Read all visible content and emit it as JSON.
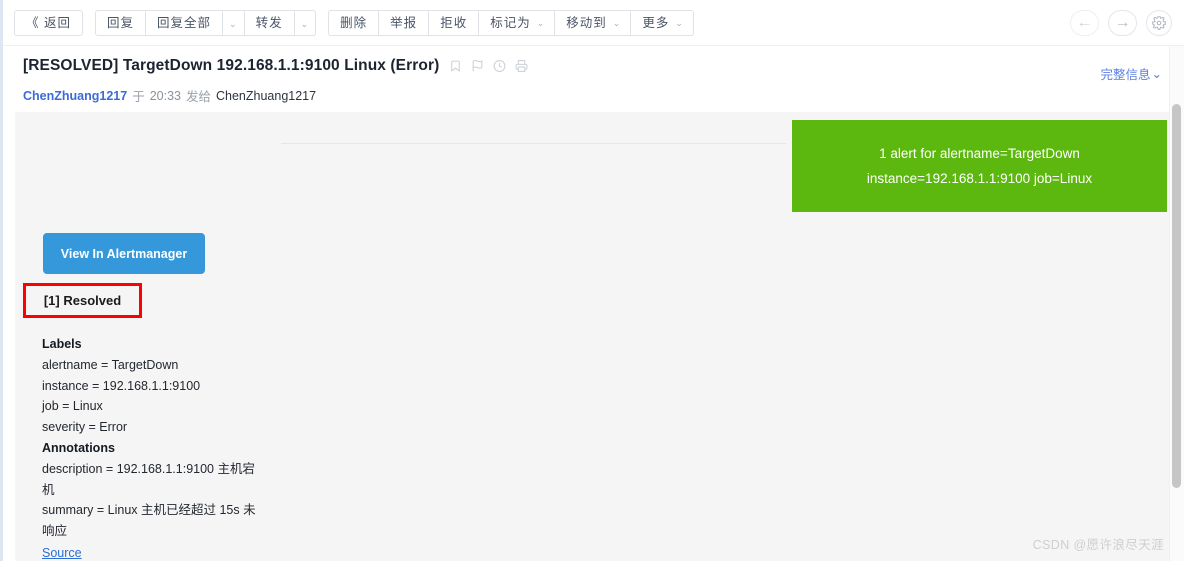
{
  "toolbar": {
    "back": "返回",
    "back_icon": "double-chevron-left-icon",
    "reply": "回复",
    "reply_all": "回复全部",
    "forward": "转发",
    "delete": "删除",
    "report": "举报",
    "reject": "拒收",
    "mark_as": "标记为",
    "move_to": "移动到",
    "more": "更多",
    "caret": "⌄"
  },
  "nav": {
    "prev_icon": "arrow-left-icon",
    "prev_glyph": "←",
    "next_icon": "arrow-right-icon",
    "next_glyph": "→",
    "settings_icon": "gear-icon"
  },
  "message": {
    "subject": "[RESOLVED] TargetDown 192.168.1.1:9100 Linux (Error)",
    "icons": [
      "bookmark-icon",
      "flag-icon",
      "clock-icon",
      "printer-icon"
    ],
    "full_info": "完整信息",
    "full_info_caret": "⌄",
    "sender": "ChenZhuang1217",
    "at": "于",
    "time": "20:33",
    "sent_to": "发给",
    "recipient": "ChenZhuang1217"
  },
  "alert": {
    "banner_line1": "1 alert for alertname=TargetDown",
    "banner_line2": "instance=192.168.1.1:9100 job=Linux",
    "banner_color": "#5cb80f",
    "button_label": "View In Alertmanager",
    "button_color": "#3498db",
    "resolved_label": "[1] Resolved",
    "resolved_highlight_color": "#fe0000",
    "labels_heading": "Labels",
    "labels": [
      "alertname = TargetDown",
      "instance = 192.168.1.1:9100",
      "job = Linux",
      "severity = Error"
    ],
    "annotations_heading": "Annotations",
    "annotations": [
      "description = 192.168.1.1:9100 主机宕机",
      "summary = Linux 主机已经超过 15s 未响应"
    ],
    "source_link": "Source"
  },
  "watermark": "CSDN @愿许浪尽天涯"
}
